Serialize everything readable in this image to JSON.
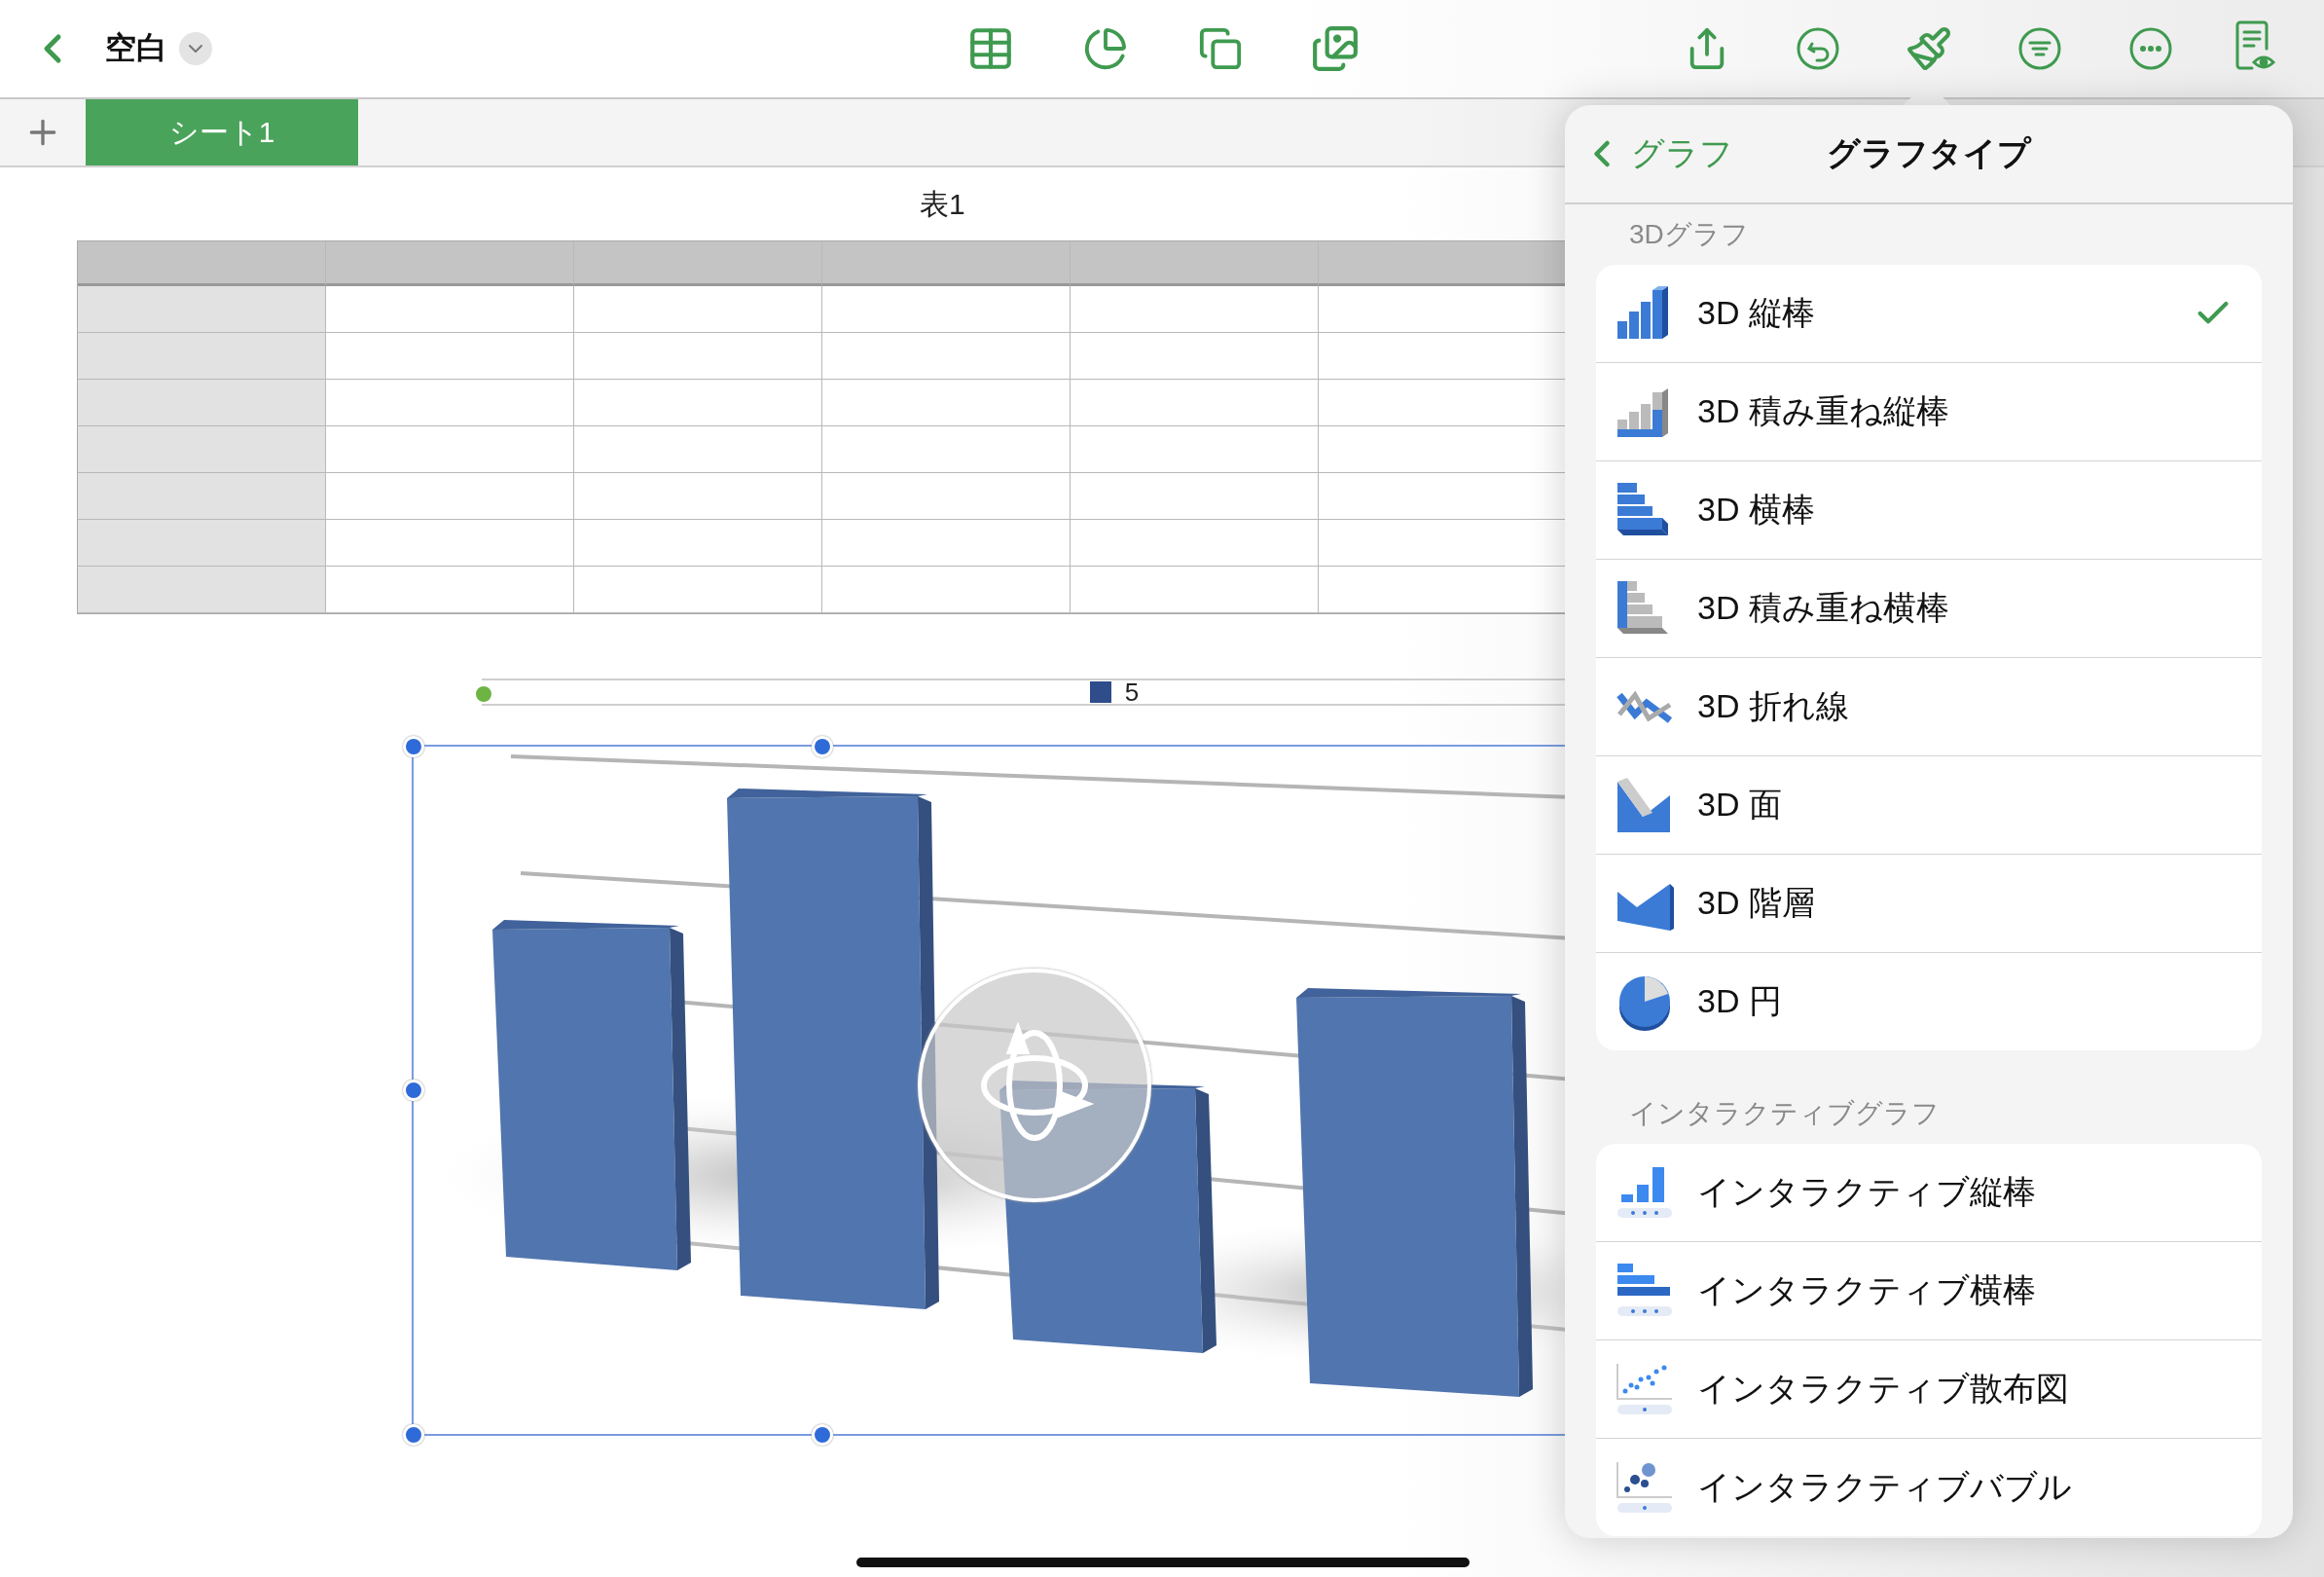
{
  "toolbar": {
    "title": "空白"
  },
  "sheets": [
    {
      "label": "シート1",
      "selected": true
    }
  ],
  "table": {
    "title": "表1"
  },
  "chart": {
    "legend": "5"
  },
  "popover": {
    "back": "グラフ",
    "title": "グラフタイプ",
    "sections": [
      {
        "header": "3Dグラフ",
        "items": [
          {
            "kind": "column3d",
            "label": "3D 縦棒",
            "selected": true
          },
          {
            "kind": "stackedcolumn3d",
            "label": "3D 積み重ね縦棒",
            "selected": false
          },
          {
            "kind": "bar3d",
            "label": "3D 横棒",
            "selected": false
          },
          {
            "kind": "stackedbar3d",
            "label": "3D 積み重ね横棒",
            "selected": false
          },
          {
            "kind": "line3d",
            "label": "3D 折れ線",
            "selected": false
          },
          {
            "kind": "area3d",
            "label": "3D 面",
            "selected": false
          },
          {
            "kind": "layer3d",
            "label": "3D 階層",
            "selected": false
          },
          {
            "kind": "pie3d",
            "label": "3D 円",
            "selected": false
          }
        ]
      },
      {
        "header": "インタラクティブグラフ",
        "items": [
          {
            "kind": "icolumn",
            "label": "インタラクティブ縦棒",
            "selected": false
          },
          {
            "kind": "ibar",
            "label": "インタラクティブ横棒",
            "selected": false
          },
          {
            "kind": "iscatter",
            "label": "インタラクティブ散布図",
            "selected": false
          },
          {
            "kind": "ibubble",
            "label": "インタラクティブバブル",
            "selected": false
          }
        ]
      }
    ]
  }
}
